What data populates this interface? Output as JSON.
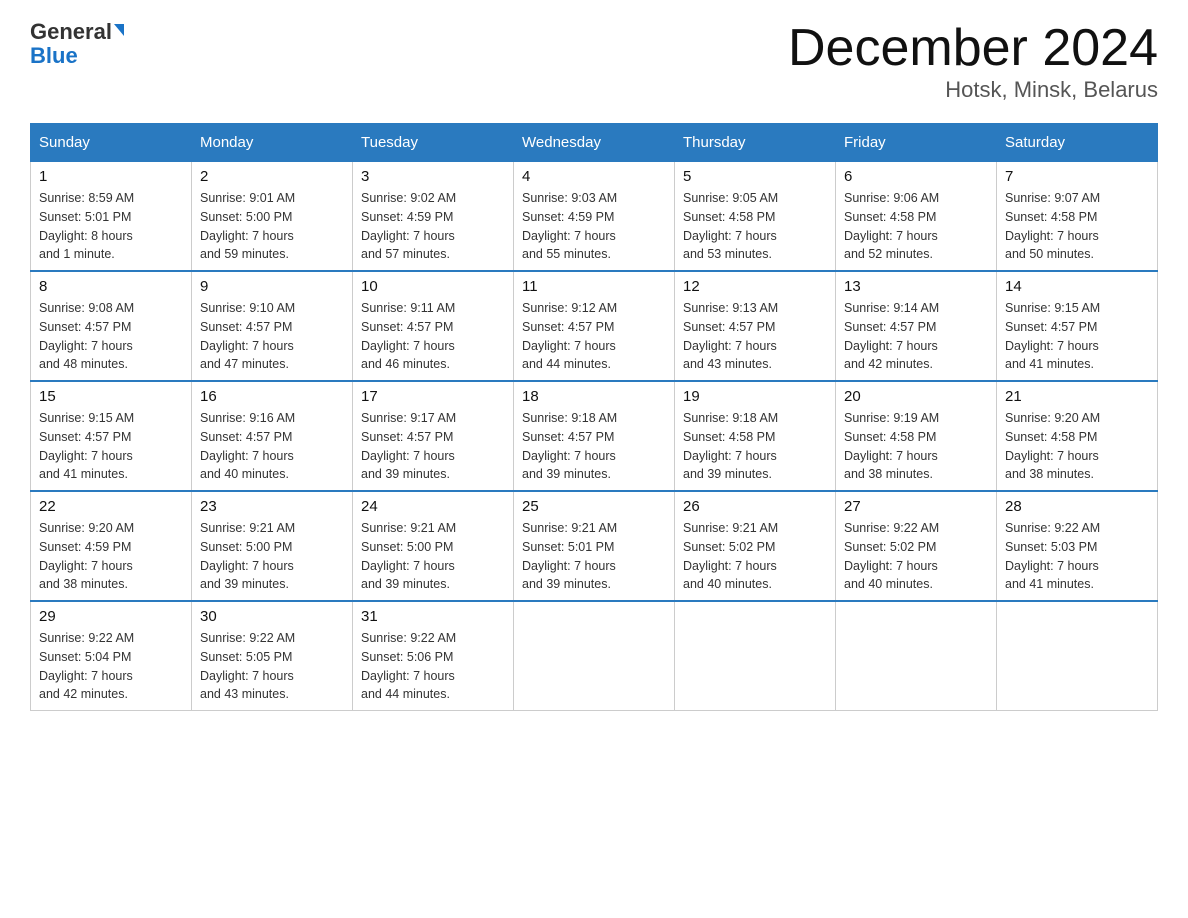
{
  "logo": {
    "text_general": "General",
    "text_blue": "Blue"
  },
  "title": "December 2024",
  "subtitle": "Hotsk, Minsk, Belarus",
  "days_of_week": [
    "Sunday",
    "Monday",
    "Tuesday",
    "Wednesday",
    "Thursday",
    "Friday",
    "Saturday"
  ],
  "weeks": [
    [
      {
        "day": "1",
        "info": "Sunrise: 8:59 AM\nSunset: 5:01 PM\nDaylight: 8 hours\nand 1 minute."
      },
      {
        "day": "2",
        "info": "Sunrise: 9:01 AM\nSunset: 5:00 PM\nDaylight: 7 hours\nand 59 minutes."
      },
      {
        "day": "3",
        "info": "Sunrise: 9:02 AM\nSunset: 4:59 PM\nDaylight: 7 hours\nand 57 minutes."
      },
      {
        "day": "4",
        "info": "Sunrise: 9:03 AM\nSunset: 4:59 PM\nDaylight: 7 hours\nand 55 minutes."
      },
      {
        "day": "5",
        "info": "Sunrise: 9:05 AM\nSunset: 4:58 PM\nDaylight: 7 hours\nand 53 minutes."
      },
      {
        "day": "6",
        "info": "Sunrise: 9:06 AM\nSunset: 4:58 PM\nDaylight: 7 hours\nand 52 minutes."
      },
      {
        "day": "7",
        "info": "Sunrise: 9:07 AM\nSunset: 4:58 PM\nDaylight: 7 hours\nand 50 minutes."
      }
    ],
    [
      {
        "day": "8",
        "info": "Sunrise: 9:08 AM\nSunset: 4:57 PM\nDaylight: 7 hours\nand 48 minutes."
      },
      {
        "day": "9",
        "info": "Sunrise: 9:10 AM\nSunset: 4:57 PM\nDaylight: 7 hours\nand 47 minutes."
      },
      {
        "day": "10",
        "info": "Sunrise: 9:11 AM\nSunset: 4:57 PM\nDaylight: 7 hours\nand 46 minutes."
      },
      {
        "day": "11",
        "info": "Sunrise: 9:12 AM\nSunset: 4:57 PM\nDaylight: 7 hours\nand 44 minutes."
      },
      {
        "day": "12",
        "info": "Sunrise: 9:13 AM\nSunset: 4:57 PM\nDaylight: 7 hours\nand 43 minutes."
      },
      {
        "day": "13",
        "info": "Sunrise: 9:14 AM\nSunset: 4:57 PM\nDaylight: 7 hours\nand 42 minutes."
      },
      {
        "day": "14",
        "info": "Sunrise: 9:15 AM\nSunset: 4:57 PM\nDaylight: 7 hours\nand 41 minutes."
      }
    ],
    [
      {
        "day": "15",
        "info": "Sunrise: 9:15 AM\nSunset: 4:57 PM\nDaylight: 7 hours\nand 41 minutes."
      },
      {
        "day": "16",
        "info": "Sunrise: 9:16 AM\nSunset: 4:57 PM\nDaylight: 7 hours\nand 40 minutes."
      },
      {
        "day": "17",
        "info": "Sunrise: 9:17 AM\nSunset: 4:57 PM\nDaylight: 7 hours\nand 39 minutes."
      },
      {
        "day": "18",
        "info": "Sunrise: 9:18 AM\nSunset: 4:57 PM\nDaylight: 7 hours\nand 39 minutes."
      },
      {
        "day": "19",
        "info": "Sunrise: 9:18 AM\nSunset: 4:58 PM\nDaylight: 7 hours\nand 39 minutes."
      },
      {
        "day": "20",
        "info": "Sunrise: 9:19 AM\nSunset: 4:58 PM\nDaylight: 7 hours\nand 38 minutes."
      },
      {
        "day": "21",
        "info": "Sunrise: 9:20 AM\nSunset: 4:58 PM\nDaylight: 7 hours\nand 38 minutes."
      }
    ],
    [
      {
        "day": "22",
        "info": "Sunrise: 9:20 AM\nSunset: 4:59 PM\nDaylight: 7 hours\nand 38 minutes."
      },
      {
        "day": "23",
        "info": "Sunrise: 9:21 AM\nSunset: 5:00 PM\nDaylight: 7 hours\nand 39 minutes."
      },
      {
        "day": "24",
        "info": "Sunrise: 9:21 AM\nSunset: 5:00 PM\nDaylight: 7 hours\nand 39 minutes."
      },
      {
        "day": "25",
        "info": "Sunrise: 9:21 AM\nSunset: 5:01 PM\nDaylight: 7 hours\nand 39 minutes."
      },
      {
        "day": "26",
        "info": "Sunrise: 9:21 AM\nSunset: 5:02 PM\nDaylight: 7 hours\nand 40 minutes."
      },
      {
        "day": "27",
        "info": "Sunrise: 9:22 AM\nSunset: 5:02 PM\nDaylight: 7 hours\nand 40 minutes."
      },
      {
        "day": "28",
        "info": "Sunrise: 9:22 AM\nSunset: 5:03 PM\nDaylight: 7 hours\nand 41 minutes."
      }
    ],
    [
      {
        "day": "29",
        "info": "Sunrise: 9:22 AM\nSunset: 5:04 PM\nDaylight: 7 hours\nand 42 minutes."
      },
      {
        "day": "30",
        "info": "Sunrise: 9:22 AM\nSunset: 5:05 PM\nDaylight: 7 hours\nand 43 minutes."
      },
      {
        "day": "31",
        "info": "Sunrise: 9:22 AM\nSunset: 5:06 PM\nDaylight: 7 hours\nand 44 minutes."
      },
      {
        "day": "",
        "info": ""
      },
      {
        "day": "",
        "info": ""
      },
      {
        "day": "",
        "info": ""
      },
      {
        "day": "",
        "info": ""
      }
    ]
  ]
}
